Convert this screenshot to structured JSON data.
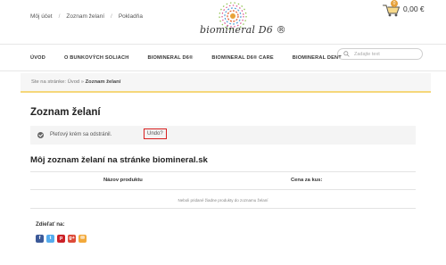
{
  "top_links": [
    "Môj účet",
    "Zoznam želaní",
    "Pokladňa"
  ],
  "logo": {
    "text": "biomineral D6 ®"
  },
  "cart": {
    "count": "0",
    "total": "0,00 €"
  },
  "nav": {
    "items": [
      "ÚVOD",
      "O BUNKOVÝCH SOLIACH",
      "BIOMINERAL D6®",
      "BIOMINERAL D6® CARE",
      "BIOMINERAL DENT"
    ]
  },
  "search": {
    "placeholder": "Zadajte text"
  },
  "breadcrumb": {
    "prefix": "Ste na stránke: ",
    "home": "Úvod",
    "sep": " » ",
    "current": "Zoznam želaní"
  },
  "page_title": "Zoznam želaní",
  "notice": {
    "text": "Pleťový krém sa odstránil.",
    "undo": "Undo?"
  },
  "wishlist": {
    "title": "Môj zoznam želaní na stránke biomineral.sk",
    "col_name": "Názov produktu",
    "col_price": "Cena za kus:",
    "empty": "Neboli pridané žiadne produkty do zoznamu želaní"
  },
  "share": {
    "title": "Zdieľať na:",
    "icons": [
      {
        "name": "facebook-icon",
        "glyph": "f",
        "color": "#3b5998"
      },
      {
        "name": "twitter-icon",
        "glyph": "t",
        "color": "#55acee"
      },
      {
        "name": "pinterest-icon",
        "glyph": "p",
        "color": "#cb2027"
      },
      {
        "name": "googleplus-icon",
        "glyph": "g+",
        "color": "#dd4b39"
      },
      {
        "name": "email-icon",
        "glyph": "✉",
        "color": "#f2a93b"
      }
    ]
  }
}
